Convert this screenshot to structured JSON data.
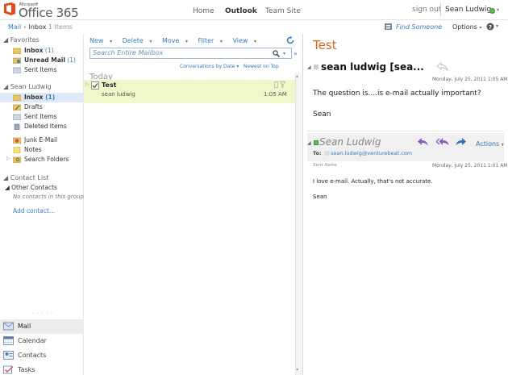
{
  "header": {
    "logo_ms": "Microsoft",
    "logo_text": "Office 365",
    "nav": [
      "Home",
      "Outlook",
      "Team Site"
    ],
    "sign_out": "sign out",
    "user": "Sean Ludwig"
  },
  "subbar": {
    "mail": "Mail",
    "inbox": "Inbox",
    "count": "1 Items",
    "find_someone": "Find Someone",
    "options": "Options"
  },
  "leftnav": {
    "favorites": "Favorites",
    "fav_items": [
      {
        "label": "Inbox",
        "count": "(1)"
      },
      {
        "label": "Unread Mail",
        "count": "(1)"
      },
      {
        "label": "Sent Items",
        "count": ""
      }
    ],
    "account": "Sean Ludwig",
    "folders": [
      {
        "label": "Inbox",
        "count": "(1)"
      },
      {
        "label": "Drafts",
        "count": ""
      },
      {
        "label": "Sent Items",
        "count": ""
      },
      {
        "label": "Deleted Items",
        "count": ""
      },
      {
        "label": "Junk E-Mail",
        "count": ""
      },
      {
        "label": "Notes",
        "count": ""
      },
      {
        "label": "Search Folders",
        "count": ""
      }
    ],
    "contact_list": "Contact List",
    "other_contacts": "Other Contacts",
    "no_contacts": "No contacts in this group",
    "add_contact": "Add contact...",
    "modules": [
      "Mail",
      "Calendar",
      "Contacts",
      "Tasks"
    ]
  },
  "list": {
    "toolbar": [
      "New",
      "Delete",
      "Move",
      "Filter",
      "View"
    ],
    "search_placeholder": "Search Entire Mailbox",
    "conv_by": "Conversations by Date",
    "newest": "Newest on Top",
    "group": "Today",
    "message": {
      "subject": "Test",
      "from": "sean ludwig",
      "time": "1:05 AM"
    }
  },
  "reading": {
    "title": "Test",
    "sender1": "sean ludwig [sea...",
    "date1": "Monday, July 25, 2011 1:05 AM",
    "body1": "The question is....is e-mail actually important?",
    "sign1": "Sean",
    "sender2": "Sean Ludwig",
    "to_label": "To:",
    "to": "sean.ludwig@venturebeat.com",
    "actions": "Actions",
    "folder": "Sent Items",
    "date2": "Monday, July 25, 2011 1:01 AM",
    "body2": "I love e-mail. Actually, that's not accurate.",
    "sign2": "Sean"
  },
  "colors": {
    "accent": "#3a7bbd",
    "title_orange": "#e0621a",
    "selected_row": "#f1f7c8"
  }
}
